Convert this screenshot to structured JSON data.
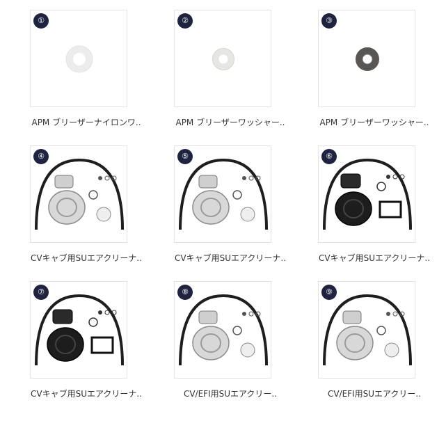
{
  "products": [
    {
      "num": "①",
      "title": "APM ブリーザーナイロンワ..",
      "image": "washer-white-icon"
    },
    {
      "num": "②",
      "title": "APM ブリーザーワッシャー..",
      "image": "washer-white-icon"
    },
    {
      "num": "③",
      "title": "APM ブリーザーワッシャー..",
      "image": "washer-dark-icon"
    },
    {
      "num": "④",
      "title": "CVキャブ用SUエアクリーナ..",
      "image": "air-cleaner-kit-chrome-icon"
    },
    {
      "num": "⑤",
      "title": "CVキャブ用SUエアクリーナ..",
      "image": "air-cleaner-kit-chrome-icon"
    },
    {
      "num": "⑥",
      "title": "CVキャブ用SUエアクリーナ..",
      "image": "air-cleaner-kit-black-icon"
    },
    {
      "num": "⑦",
      "title": "CVキャブ用SUエアクリーナ..",
      "image": "air-cleaner-kit-black-icon"
    },
    {
      "num": "⑧",
      "title": "CV/EFI用SUエアクリー..",
      "image": "air-cleaner-kit-chrome-icon"
    },
    {
      "num": "⑨",
      "title": "CV/EFI用SUエアクリー..",
      "image": "air-cleaner-kit-chrome-icon"
    }
  ]
}
